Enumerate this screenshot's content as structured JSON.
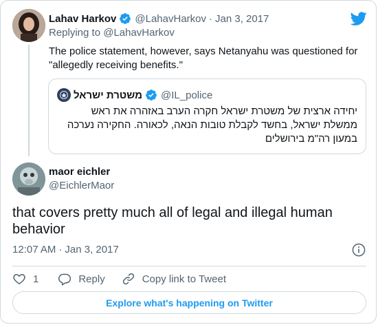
{
  "parent_tweet": {
    "display_name": "Lahav Harkov",
    "handle": "@LahavHarkov",
    "date": "Jan 3, 2017",
    "replying_to": "Replying to @LahavHarkov",
    "text": "The police statement, however, says Netanyahu was questioned for \"allegedly receiving benefits.\"",
    "verified": true
  },
  "quoted_tweet": {
    "display_name": "משטרת ישראל",
    "handle": "@IL_police",
    "text": "יחידה ארצית של משטרת ישראל חקרה הערב באזהרה את ראש ממשלת ישראל, בחשד לקבלת טובות הנאה, לכאורה. החקירה נערכה במעון רה\"מ בירושלים",
    "verified": true
  },
  "main_tweet": {
    "display_name": "maor eichler",
    "handle": "@EichlerMaor",
    "text": "that covers pretty much all of legal and illegal human behavior",
    "time": "12:07 AM",
    "date": "Jan 3, 2017"
  },
  "actions": {
    "like_count": "1",
    "reply_label": "Reply",
    "copy_link_label": "Copy link to Tweet"
  },
  "explore_label": "Explore what's happening on Twitter",
  "icons": {
    "brand": "twitter-bird-icon",
    "verified": "verified-badge-icon",
    "info": "info-icon",
    "like": "heart-icon",
    "reply": "speech-bubble-icon",
    "copy_link": "link-icon"
  },
  "colors": {
    "accent": "#1d9bf0",
    "text": "#0f1419",
    "secondary_text": "#536471",
    "border": "#cfd9de"
  }
}
